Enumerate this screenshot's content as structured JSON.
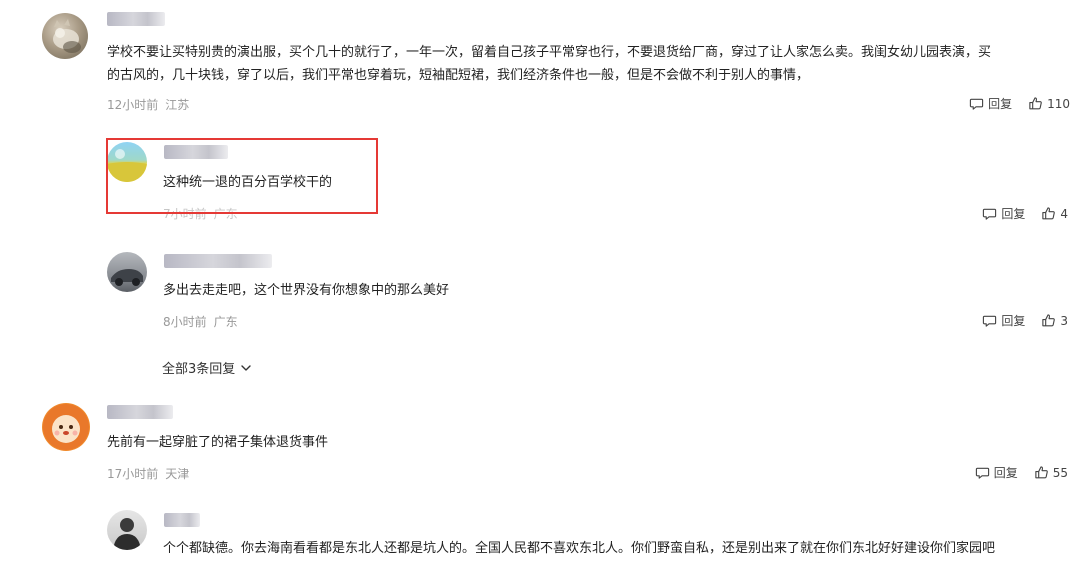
{
  "comments": [
    {
      "text_line1": "学校不要让买特别贵的演出服，买个几十的就行了，一年一次，留着自己孩子平常穿也行，不要退货给厂商，穿过了让人家怎么卖。我闺女幼儿园表演，买",
      "text_line2": "的古风的，几十块钱，穿了以后，我们平常也穿着玩，短袖配短裙，我们经济条件也一般，但是不会做不利于别人的事情，",
      "time": "12小时前",
      "location": "江苏",
      "reply_label": "回复",
      "likes": "110",
      "replies": [
        {
          "text": "这种统一退的百分百学校干的",
          "time": "7小时前",
          "location": "广东",
          "reply_label": "回复",
          "likes": "4"
        },
        {
          "text": "多出去走走吧，这个世界没有你想象中的那么美好",
          "time": "8小时前",
          "location": "广东",
          "reply_label": "回复",
          "likes": "3"
        }
      ],
      "expand_label": "全部3条回复"
    },
    {
      "text": "先前有一起穿脏了的裙子集体退货事件",
      "time": "17小时前",
      "location": "天津",
      "reply_label": "回复",
      "likes": "55",
      "replies": [
        {
          "text": "个个都缺德。你去海南看看都是东北人还都是坑人的。全国人民都不喜欢东北人。你们野蛮自私，还是别出来了就在你们东北好好建设你们家园吧"
        }
      ]
    }
  ],
  "colors": {
    "highlight": "#e53935",
    "meta_text": "#999999",
    "body_text": "#222222"
  }
}
